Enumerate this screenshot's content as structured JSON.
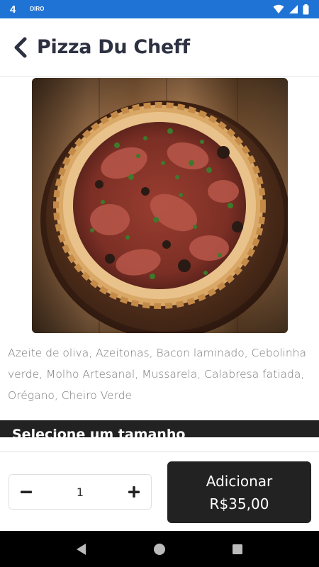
{
  "status_bar": {
    "time": "4",
    "app_icon_label": "DIRO"
  },
  "header": {
    "title": "Pizza Du Cheff",
    "back_icon": "chevron-left-icon"
  },
  "product": {
    "image_alt": "pizza-photo",
    "description": "Azeite de oliva, Azeitonas, Bacon laminado, Cebolinha verde, Molho Artesanal, Mussarela, Calabresa fatiada, Orégano, Cheiro Verde"
  },
  "size_section": {
    "title": "Selecione um tamanho"
  },
  "quantity": {
    "value": "1",
    "minus_icon": "minus-icon",
    "plus_icon": "plus-icon"
  },
  "add_button": {
    "label": "Adicionar",
    "price": "R$35,00"
  },
  "colors": {
    "status_bar": "#1f73d4",
    "title_text": "#2d3142",
    "dark_button": "#222222",
    "description_text": "#7a7a7a"
  }
}
